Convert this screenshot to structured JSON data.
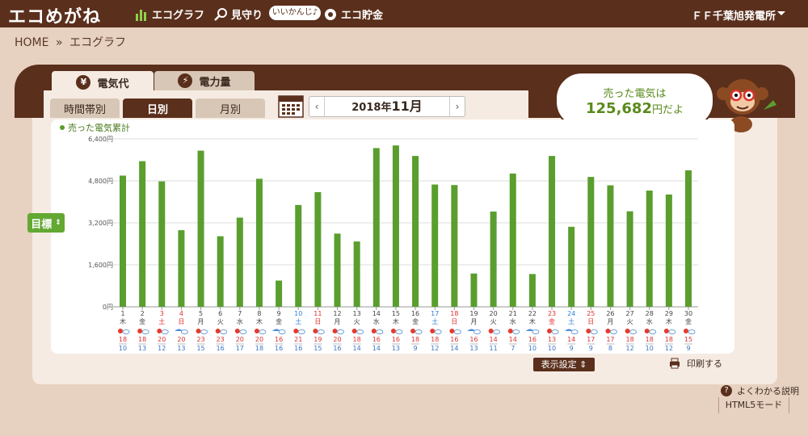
{
  "topbar": {
    "logo": "エコめがね",
    "nav": [
      {
        "label": "エコグラフ",
        "icon": "bar-chart-icon"
      },
      {
        "label": "見守り",
        "icon": "magnifier-icon"
      },
      {
        "label": "エコ貯金",
        "icon": "piggy-icon"
      }
    ],
    "bubble": "いいかんじ♪",
    "plant_name": "ＦＦ千葉旭発電所"
  },
  "breadcrumb": {
    "home": "HOME",
    "separator": "»",
    "current": "エコグラフ"
  },
  "main_tabs": [
    {
      "label": "電気代",
      "icon": "yen-icon",
      "active": true
    },
    {
      "label": "電力量",
      "icon": "bolt-icon",
      "active": false
    }
  ],
  "sub_tabs": [
    {
      "label": "時間帯別",
      "active": false
    },
    {
      "label": "日別",
      "active": true
    },
    {
      "label": "月別",
      "active": false
    }
  ],
  "date_nav": {
    "year": "2018年",
    "month": "11月",
    "prev": "‹",
    "next": "›"
  },
  "speech": {
    "line1": "売った電気は",
    "amount": "125,682",
    "suffix": "円だよ"
  },
  "goal_button": "目標",
  "display_settings": "表示設定",
  "print_label": "印刷する",
  "help_label": "よくわかる説明",
  "html5_label": "HTML5モード",
  "colors": {
    "bar": "#5a9e2e",
    "brown": "#5a2f1c",
    "sat": "#2f7fd6",
    "sun": "#e0302a"
  },
  "chart_data": {
    "type": "bar",
    "legend": "売った電気累計",
    "ylim": [
      0,
      6400
    ],
    "yticks": [
      "0円",
      "1,600円",
      "3,200円",
      "4,800円",
      "6,400円"
    ],
    "yvals": [
      0,
      1600,
      3200,
      4800,
      6400
    ],
    "days": [
      "1",
      "2",
      "3",
      "4",
      "5",
      "6",
      "7",
      "8",
      "9",
      "10",
      "11",
      "12",
      "13",
      "14",
      "15",
      "16",
      "17",
      "18",
      "19",
      "20",
      "21",
      "22",
      "23",
      "24",
      "25",
      "26",
      "27",
      "28",
      "29",
      "30"
    ],
    "weekdays": [
      "木",
      "金",
      "土",
      "日",
      "月",
      "火",
      "水",
      "木",
      "金",
      "土",
      "日",
      "月",
      "火",
      "水",
      "木",
      "金",
      "土",
      "日",
      "月",
      "火",
      "水",
      "木",
      "金",
      "土",
      "日",
      "月",
      "火",
      "水",
      "木",
      "金"
    ],
    "day_types": [
      "w",
      "w",
      "h",
      "h",
      "w",
      "w",
      "w",
      "w",
      "w",
      "s",
      "h",
      "w",
      "w",
      "w",
      "w",
      "w",
      "s",
      "h",
      "w",
      "w",
      "w",
      "w",
      "h",
      "s",
      "h",
      "w",
      "w",
      "w",
      "w",
      "w"
    ],
    "values": [
      5000,
      5550,
      4780,
      2920,
      5950,
      2690,
      3400,
      4880,
      1000,
      3880,
      4370,
      2790,
      2490,
      6050,
      6150,
      5750,
      4660,
      4640,
      1270,
      3630,
      5080,
      1250,
      5750,
      3050,
      4950,
      4630,
      3640,
      4430,
      4280,
      5200
    ],
    "weather": [
      "sunny-cloudy",
      "sunny-cloudy",
      "sunny-rain",
      "rain-cloudy",
      "sunny-cloudy",
      "sunny-cloudy",
      "sunny-cloudy",
      "sunny-cloudy",
      "rain-cloudy",
      "sunny-cloudy",
      "sunny-cloudy",
      "sunny-cloudy",
      "sunny-cloudy",
      "sunny-cloudy",
      "sunny-cloudy",
      "sunny-cloudy",
      "sunny-cloudy",
      "sunny-cloudy",
      "rain-cloudy",
      "sunny-cloudy",
      "sunny-cloudy",
      "rain-cloudy",
      "sunny-cloudy",
      "rain-cloudy",
      "sunny-cloudy",
      "sunny-cloudy",
      "sunny-cloudy",
      "sunny-cloudy",
      "sunny-cloudy",
      "sunny-cloudy"
    ],
    "temp_high": [
      "18",
      "18",
      "20",
      "20",
      "23",
      "23",
      "20",
      "20",
      "16",
      "21",
      "19",
      "20",
      "18",
      "16",
      "16",
      "18",
      "18",
      "16",
      "16",
      "14",
      "14",
      "16",
      "13",
      "14",
      "17",
      "17",
      "18",
      "18",
      "18",
      "15"
    ],
    "temp_low": [
      "10",
      "13",
      "12",
      "13",
      "15",
      "16",
      "17",
      "18",
      "16",
      "16",
      "15",
      "16",
      "14",
      "14",
      "13",
      "9",
      "12",
      "14",
      "13",
      "11",
      "7",
      "10",
      "10",
      "9",
      "9",
      "8",
      "12",
      "10",
      "12",
      "9"
    ]
  }
}
